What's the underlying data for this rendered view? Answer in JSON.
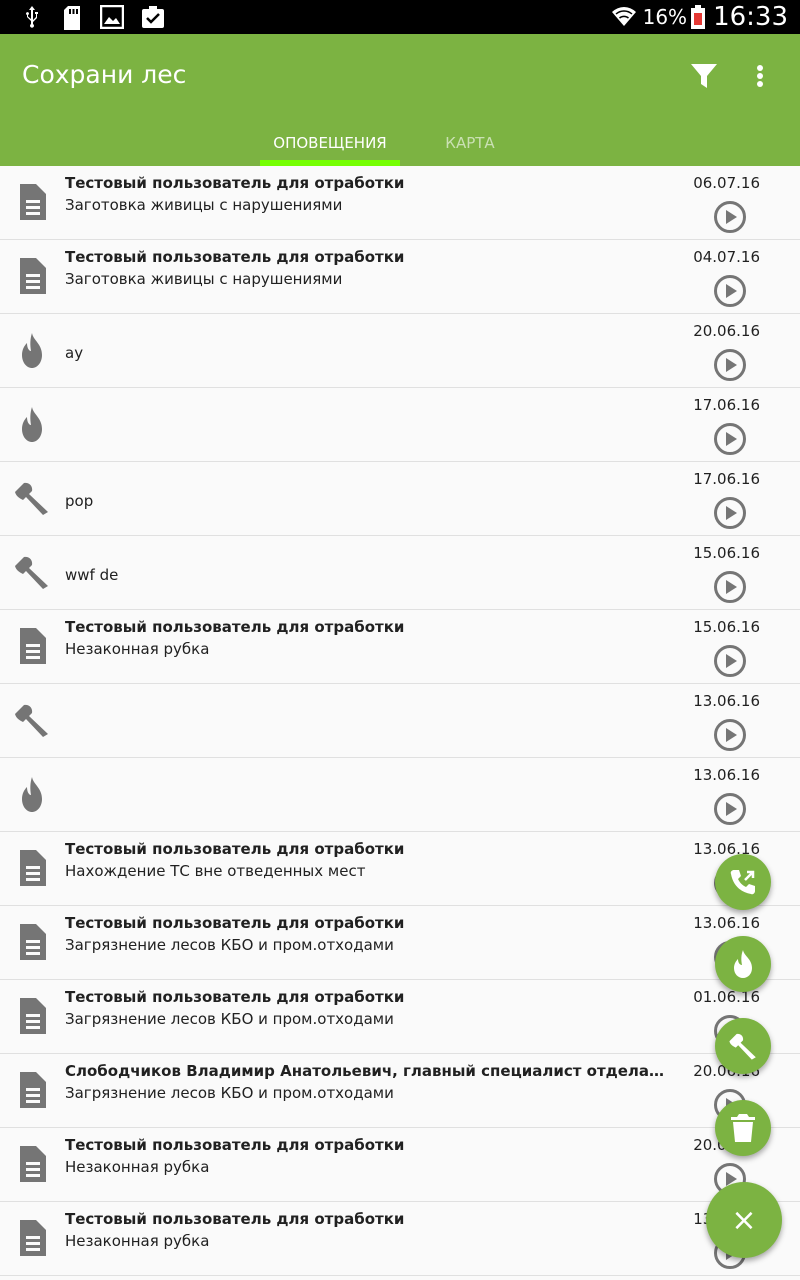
{
  "status_bar": {
    "icons_left": [
      "usb-icon",
      "sd-card-icon",
      "image-icon",
      "clipboard-icon"
    ],
    "battery": "16%",
    "time": "16:33"
  },
  "app": {
    "title": "Сохрани лес",
    "actions": [
      "filter-icon",
      "more-vert-icon"
    ],
    "tabs": [
      {
        "label": "ОПОВЕЩЕНИЯ",
        "active": true
      },
      {
        "label": "КАРТА",
        "active": false
      }
    ]
  },
  "colors": {
    "primary": "#7cb342",
    "tab_indicator": "#76ff03",
    "icon_grey": "#757575"
  },
  "alerts": [
    {
      "type": "document",
      "author": "Тестовый пользователь для отработки",
      "text": "Заготовка живицы с нарушениями",
      "date": "06.07.16"
    },
    {
      "type": "document",
      "author": "Тестовый пользователь для отработки",
      "text": "Заготовка живицы с нарушениями",
      "date": "04.07.16"
    },
    {
      "type": "fire",
      "author": "",
      "text": "ay",
      "date": "20.06.16"
    },
    {
      "type": "fire",
      "author": "",
      "text": "",
      "date": "17.06.16"
    },
    {
      "type": "logging",
      "author": "",
      "text": "pop",
      "date": "17.06.16"
    },
    {
      "type": "logging",
      "author": "",
      "text": "wwf de",
      "date": "15.06.16"
    },
    {
      "type": "document",
      "author": "Тестовый пользователь для отработки",
      "text": "Незаконная рубка",
      "date": "15.06.16"
    },
    {
      "type": "logging",
      "author": "",
      "text": "",
      "date": "13.06.16"
    },
    {
      "type": "fire",
      "author": "",
      "text": "",
      "date": "13.06.16"
    },
    {
      "type": "document",
      "author": "Тестовый пользователь для отработки",
      "text": "Нахождение ТС вне отведенных мест",
      "date": "13.06.16"
    },
    {
      "type": "document",
      "author": "Тестовый пользователь для отработки",
      "text": "Загрязнение лесов КБО и пром.отходами",
      "date": "13.06.16"
    },
    {
      "type": "document",
      "author": "Тестовый пользователь для отработки",
      "text": "Загрязнение лесов КБО и пром.отходами",
      "date": "01.06.16"
    },
    {
      "type": "document",
      "author": "Слободчиков Владимир Анатольевич, главный специалист отдела федераль...",
      "text": "Загрязнение лесов КБО и пром.отходами",
      "date": "20.06.16"
    },
    {
      "type": "document",
      "author": "Тестовый пользователь для отработки",
      "text": "Незаконная рубка",
      "date": "20.06.16"
    },
    {
      "type": "document",
      "author": "Тестовый пользователь для отработки",
      "text": "Незаконная рубка",
      "date": "13.06.16"
    }
  ],
  "fab_menu": {
    "items": [
      "phone-callback-icon",
      "fire-icon",
      "axe-icon",
      "trash-icon"
    ],
    "main": "×"
  }
}
